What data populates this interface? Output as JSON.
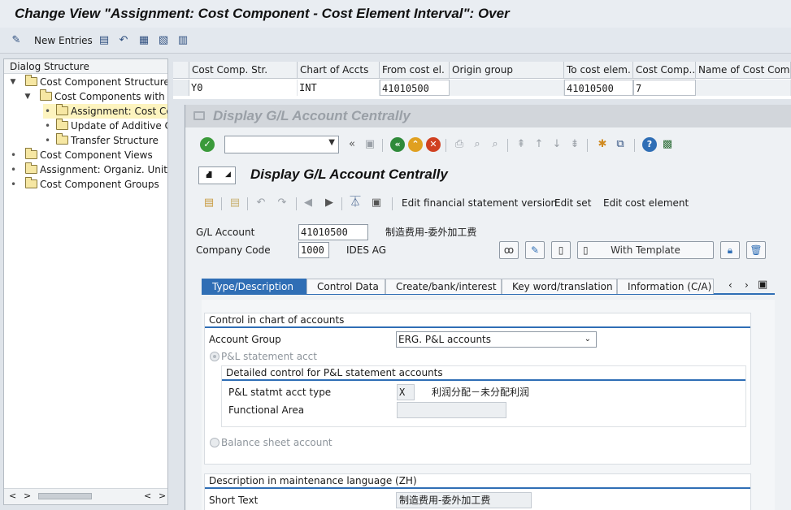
{
  "window": {
    "title": "Change View \"Assignment: Cost Component - Cost Element Interval\": Over"
  },
  "app_toolbar": {
    "new_entries_label": "New Entries"
  },
  "tree": {
    "header": "Dialog Structure",
    "items": [
      {
        "label": "Cost Component Structure"
      },
      {
        "label": "Cost Components with At"
      },
      {
        "label": "Assignment: Cost Com"
      },
      {
        "label": "Update of Additive Co"
      },
      {
        "label": "Transfer Structure"
      },
      {
        "label": "Cost Component Views"
      },
      {
        "label": "Assignment: Organiz. Units - "
      },
      {
        "label": "Cost Component Groups"
      }
    ]
  },
  "table": {
    "columns": [
      "Cost Comp. Str.",
      "Chart of Accts",
      "From cost el.",
      "Origin group",
      "To cost elem.",
      "Cost Comp...",
      "Name of Cost Comp."
    ],
    "row": [
      "Y0",
      "INT",
      "41010500",
      "",
      "41010500",
      "7",
      ""
    ]
  },
  "popup": {
    "window_title": "Display G/L Account Centrally",
    "screen_title": "Display G/L Account Centrally",
    "toolbar": {
      "edit_fs_version": "Edit financial statement version",
      "edit_set": "Edit set",
      "edit_cost_element": "Edit cost element"
    },
    "gl_account": {
      "label": "G/L Account",
      "value": "41010500",
      "description": "制造费用-委外加工费"
    },
    "company_code": {
      "label": "Company Code",
      "value": "1000",
      "name": "IDES AG"
    },
    "with_template_label": "With Template",
    "tabs": [
      "Type/Description",
      "Control Data",
      "Create/bank/interest",
      "Key word/translation",
      "Information (C/A)"
    ],
    "active_tab": "Type/Description",
    "control_group": {
      "title": "Control in chart of accounts",
      "account_group_label": "Account Group",
      "account_group_value": "ERG. P&L accounts",
      "pl_radio_label": "P&L statement acct",
      "detail_title": "Detailed control for P&L statement accounts",
      "pl_type_label": "P&L statmt acct type",
      "pl_type_value": "X",
      "pl_type_text": "利润分配－未分配利润",
      "functional_area_label": "Functional Area",
      "functional_area_value": "",
      "bs_radio_label": "Balance sheet account"
    },
    "description_group": {
      "title": "Description in maintenance language (ZH)",
      "short_text_label": "Short Text",
      "short_text_value": "制造费用-委外加工费"
    }
  },
  "colors": {
    "accent": "#2f6eb5",
    "selected_row": "#fdf4bf",
    "ok_green": "#3a9a3a"
  }
}
